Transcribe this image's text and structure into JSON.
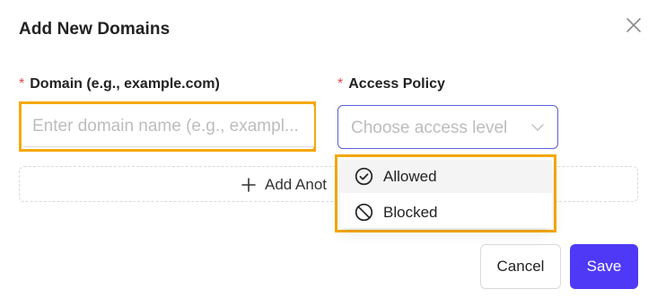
{
  "modal": {
    "title": "Add New Domains"
  },
  "form": {
    "domain": {
      "required_mark": "*",
      "label": "Domain (e.g., example.com)",
      "value": "",
      "placeholder": "Enter domain name (e.g., exampl..."
    },
    "access_policy": {
      "required_mark": "*",
      "label": "Access Policy",
      "placeholder": "Choose access level",
      "options": [
        {
          "label": "Allowed",
          "icon": "check-circle-icon"
        },
        {
          "label": "Blocked",
          "icon": "blocked-icon"
        }
      ]
    },
    "add_another_label": "Add Anot"
  },
  "footer": {
    "cancel_label": "Cancel",
    "save_label": "Save"
  },
  "colors": {
    "primary": "#4f39f6",
    "highlight": "#f5a90a",
    "required": "#e5484d",
    "select_border": "#5b5fd9"
  }
}
